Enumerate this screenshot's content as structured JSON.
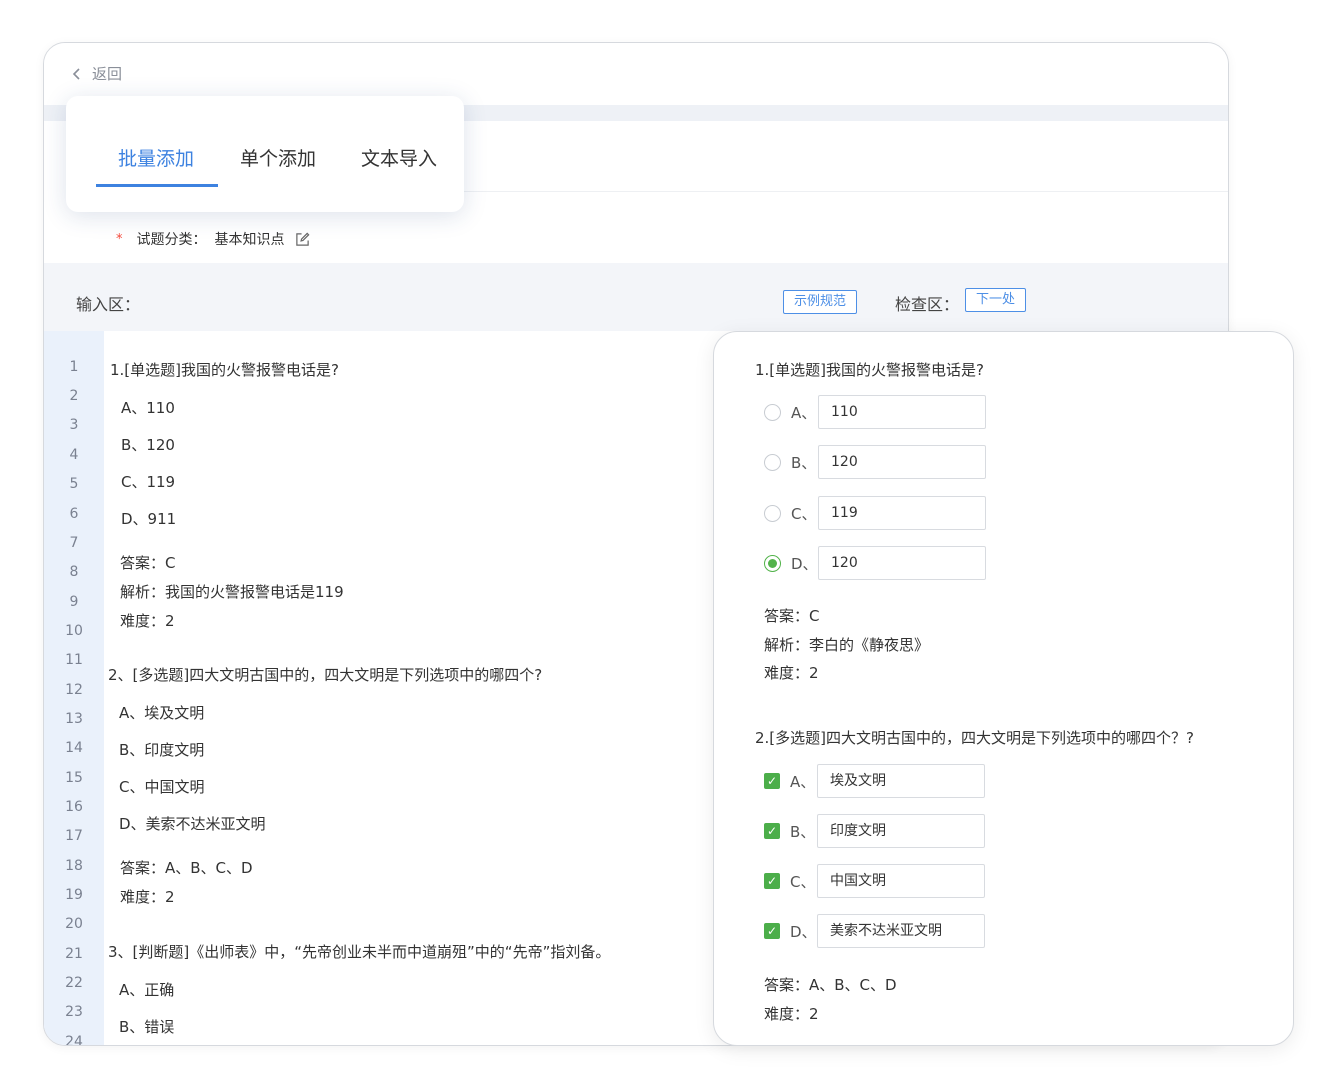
{
  "nav": {
    "back_label": "返回"
  },
  "tabs": [
    {
      "label": "批量添加",
      "active": true
    },
    {
      "label": "单个添加",
      "active": false
    },
    {
      "label": "文本导入",
      "active": false
    }
  ],
  "form": {
    "required_mark": "*",
    "category_label": "试题分类：",
    "category_value": "基本知识点"
  },
  "input_area": {
    "label": "输入区：",
    "example_button": "示例规范"
  },
  "check_area": {
    "label": "检查区：",
    "next_button": "下一处"
  },
  "editor": {
    "line_numbers": [
      "1",
      "2",
      "3",
      "4",
      "5",
      "6",
      "7",
      "8",
      "9",
      "10",
      "11",
      "12",
      "13",
      "14",
      "15",
      "16",
      "17",
      "18",
      "19",
      "20",
      "21",
      "22",
      "23",
      "24"
    ],
    "lines": [
      "1.[单选题]我国的火警报警电话是?",
      "A、110",
      "B、120",
      "C、119",
      "D、911",
      "答案：C",
      "解析：我国的火警报警电话是119",
      "难度：2",
      "2、[多选题]四大文明古国中的，四大文明是下列选项中的哪四个?",
      "A、埃及文明",
      "B、印度文明",
      "C、中国文明",
      "D、美索不达米亚文明",
      "答案：A、B、C、D",
      "难度：2",
      "3、[判断题]《出师表》中，“先帝创业未半而中道崩殂”中的“先帝”指刘备。",
      "A、正确",
      "B、错误"
    ]
  },
  "preview": {
    "q1": {
      "title": "1.[单选题]我国的火警报警电话是?",
      "options": [
        {
          "letter": "A、",
          "value": "110",
          "checked": false
        },
        {
          "letter": "B、",
          "value": "120",
          "checked": false
        },
        {
          "letter": "C、",
          "value": "119",
          "checked": false
        },
        {
          "letter": "D、",
          "value": "120",
          "checked": true
        }
      ],
      "answer": "答案：C",
      "analysis": "解析：李白的《静夜思》",
      "difficulty": "难度：2"
    },
    "q2": {
      "title": "2.[多选题]四大文明古国中的，四大文明是下列选项中的哪四个？?",
      "options": [
        {
          "letter": "A、",
          "value": "埃及文明",
          "checked": true
        },
        {
          "letter": "B、",
          "value": "印度文明",
          "checked": true
        },
        {
          "letter": "C、",
          "value": "中国文明",
          "checked": true
        },
        {
          "letter": "D、",
          "value": "美索不达米亚文明",
          "checked": true
        }
      ],
      "answer": "答案：A、B、C、D",
      "difficulty": "难度：2"
    },
    "check_glyph": "✓"
  },
  "colors": {
    "accent": "#3d82e0",
    "success": "#4cae4a",
    "required": "#f5483b",
    "gutter": "#eaf1fb"
  }
}
